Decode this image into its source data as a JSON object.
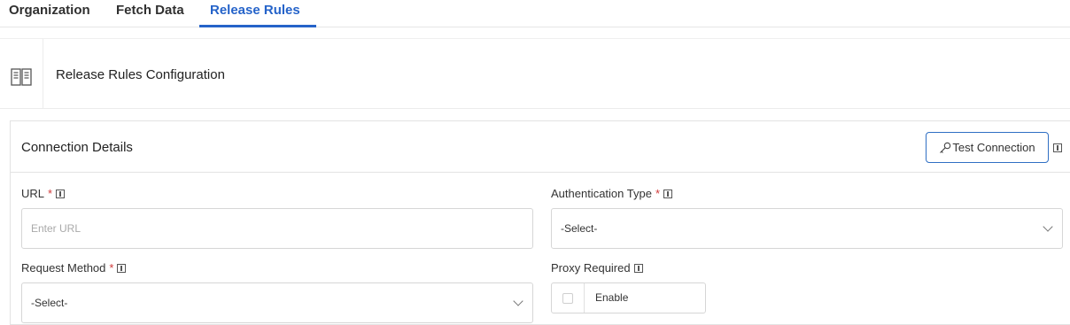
{
  "tabs": [
    {
      "label": "Organization"
    },
    {
      "label": "Fetch Data"
    },
    {
      "label": "Release Rules",
      "active": true
    }
  ],
  "header": {
    "icon": "book-icon",
    "title": "Release Rules Configuration"
  },
  "connection": {
    "title": "Connection Details",
    "test_button": {
      "label": "Test Connection",
      "icon": "key-icon"
    },
    "fields": {
      "url": {
        "label": "URL",
        "required_mark": "*",
        "placeholder": "Enter URL",
        "value": ""
      },
      "auth_type": {
        "label": "Authentication Type",
        "required_mark": "*",
        "value": "-Select-"
      },
      "request_method": {
        "label": "Request Method",
        "required_mark": "*",
        "value": "-Select-"
      },
      "proxy": {
        "label": "Proxy Required",
        "option_label": "Enable",
        "checked": false
      }
    }
  },
  "colors": {
    "accent": "#2563c9",
    "required": "#d03a3a"
  }
}
